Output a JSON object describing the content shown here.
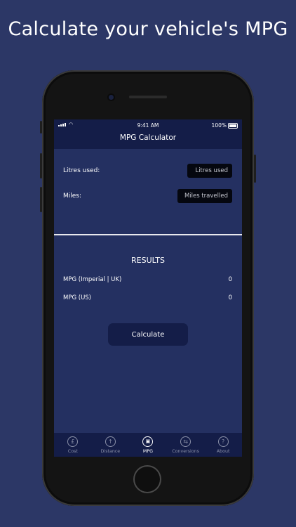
{
  "headline": "Calculate your vehicle's MPG",
  "status_bar": {
    "time": "9:41 AM",
    "battery": "100%"
  },
  "nav": {
    "title": "MPG Calculator"
  },
  "form": {
    "litres_label": "Litres used:",
    "litres_placeholder": "Litres used",
    "miles_label": "Miles:",
    "miles_placeholder": "Miles travelled"
  },
  "results": {
    "title": "RESULTS",
    "rows": [
      {
        "label": "MPG (Imperial | UK)",
        "value": "0"
      },
      {
        "label": "MPG (US)",
        "value": "0"
      }
    ]
  },
  "calculate_button": "Calculate",
  "tabs": [
    {
      "label": "Cost",
      "icon": "pound-icon",
      "glyph": "£",
      "active": false
    },
    {
      "label": "Distance",
      "icon": "distance-icon",
      "glyph": "↑",
      "active": false
    },
    {
      "label": "MPG",
      "icon": "fuel-pump-icon",
      "glyph": "⛽",
      "active": true
    },
    {
      "label": "Conversions",
      "icon": "conversions-icon",
      "glyph": "⇆",
      "active": false
    },
    {
      "label": "About",
      "icon": "help-icon",
      "glyph": "?",
      "active": false
    }
  ],
  "colors": {
    "background": "#2c3766",
    "screen": "#243061",
    "bars": "#141d48"
  }
}
